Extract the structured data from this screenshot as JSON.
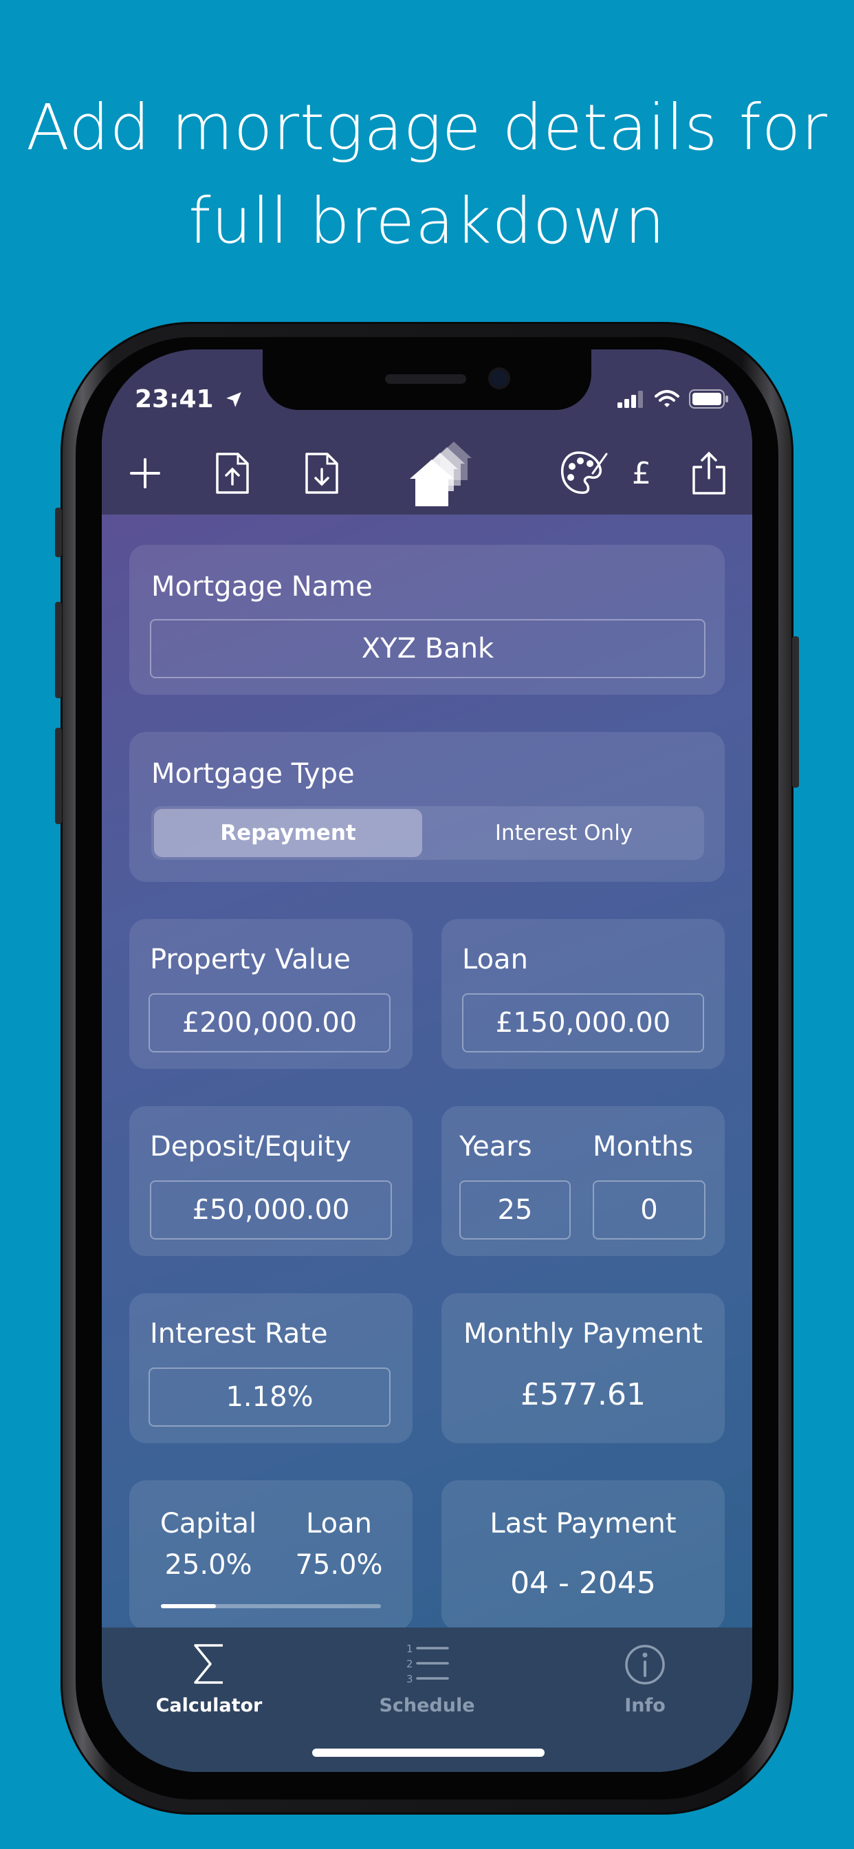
{
  "headline": {
    "line1": "Add mortgage details for",
    "line2": "full breakdown"
  },
  "status": {
    "time": "23:41"
  },
  "toolbar": {
    "currency": "£"
  },
  "mortgage_name": {
    "label": "Mortgage Name",
    "value": "XYZ Bank"
  },
  "mortgage_type": {
    "label": "Mortgage Type",
    "options": [
      "Repayment",
      "Interest Only"
    ],
    "selected": "Repayment"
  },
  "property_value": {
    "label": "Property Value",
    "value": "£200,000.00"
  },
  "loan": {
    "label": "Loan",
    "value": "£150,000.00"
  },
  "deposit": {
    "label": "Deposit/Equity",
    "value": "£50,000.00"
  },
  "term": {
    "years_label": "Years",
    "years_value": "25",
    "months_label": "Months",
    "months_value": "0"
  },
  "interest_rate": {
    "label": "Interest Rate",
    "value": "1.18%"
  },
  "monthly_payment": {
    "label": "Monthly Payment",
    "value": "£577.61"
  },
  "ratio": {
    "capital_label": "Capital",
    "capital_value": "25.0%",
    "loan_label": "Loan",
    "loan_value": "75.0%",
    "capital_fraction": 0.25
  },
  "last_payment": {
    "label": "Last Payment",
    "value": "04 - 2045"
  },
  "tabs": [
    {
      "label": "Calculator",
      "icon": "sigma-icon",
      "active": true
    },
    {
      "label": "Schedule",
      "icon": "numbered-list-icon",
      "active": false
    },
    {
      "label": "Info",
      "icon": "info-icon",
      "active": false
    }
  ],
  "colors": {
    "background": "#0394bf",
    "tab_active": "#ffffff",
    "tab_inactive": "#8a9bb0"
  }
}
